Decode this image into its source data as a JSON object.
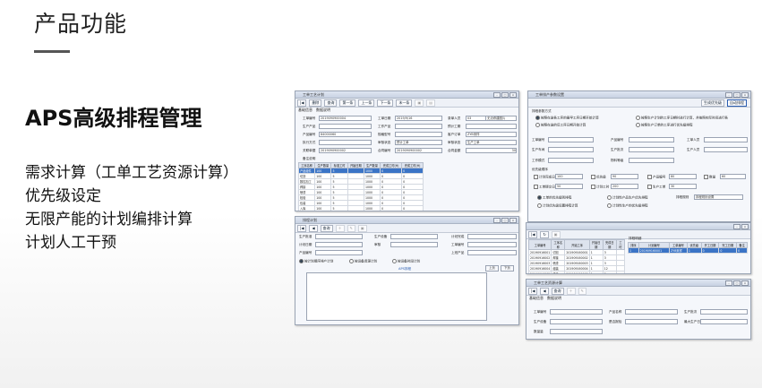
{
  "slide": {
    "title": "产品功能",
    "heading": "APS高级排程管理",
    "features": [
      "需求计算（工单工艺资源计算）",
      "优先级设定",
      "无限产能的计划编排计算",
      "计划人工干预"
    ]
  },
  "win1": {
    "title": "工单工艺计划",
    "toolbar": [
      "删除",
      "查询",
      "第一条",
      "上一条",
      "下一条",
      "末一条"
    ],
    "tabs": [
      "基础信息",
      "数据说明"
    ],
    "fields": [
      {
        "label": "工单编号",
        "value": "2019090900004"
      },
      {
        "label": "工单日期",
        "value": "2019/9/16"
      },
      {
        "label": "录单人员",
        "value": "03"
      },
      {
        "label": "",
        "value": "无法修建图片"
      },
      {
        "label": "生产产品",
        "value": ""
      },
      {
        "label": "工作产品",
        "value": ""
      },
      {
        "label": "预计工期",
        "value": ""
      },
      {
        "label": "产品编号",
        "value": "84000060"
      },
      {
        "label": "规格型号",
        "value": ""
      },
      {
        "label": "客户订单",
        "value": "ZYB采样"
      },
      {
        "label": "执行方式",
        "value": ""
      },
      {
        "label": "审核状态",
        "value": "预计工单"
      },
      {
        "label": "审核状态",
        "value": "生产工单"
      },
      {
        "label": "关联单据",
        "value": "2019090900002"
      },
      {
        "label": "合同编号",
        "value": "2019090900002"
      },
      {
        "label": "合同金额",
        "value": "30"
      },
      {
        "label": "备注说明",
        "value": ""
      }
    ],
    "grid_headers": [
      "工序名称",
      "生产数量",
      "标准工时",
      "开始日期",
      "生产数量",
      "完成工时(H)",
      "完成工时(H)"
    ],
    "grid_rows": [
      [
        "产品组件",
        "100",
        "5",
        "",
        "1000",
        "0",
        "0"
      ],
      [
        "切割",
        "100",
        "5",
        "",
        "1000",
        "0",
        "0"
      ],
      [
        "数控加工",
        "100",
        "5",
        "",
        "1000",
        "0",
        "0"
      ],
      [
        "焊接",
        "100",
        "5",
        "",
        "1000",
        "0",
        "0"
      ],
      [
        "喷漆",
        "100",
        "5",
        "",
        "1000",
        "0",
        "0"
      ],
      [
        "检验",
        "100",
        "5",
        "",
        "1000",
        "0",
        "0"
      ],
      [
        "包装",
        "100",
        "5",
        "",
        "1000",
        "0",
        "0"
      ],
      [
        "入库",
        "100",
        "5",
        "",
        "1000",
        "0",
        "0"
      ]
    ]
  },
  "win2": {
    "title": "排程计划",
    "toolbar": [
      "查询"
    ],
    "fields": [
      "生产批准",
      "生产设备",
      "计划完成",
      "计划日期",
      "审核",
      "工单编号",
      "产品编号",
      "上班产品"
    ],
    "radios": [
      "按计划顺序排产计划",
      "按设备资源计划",
      "按设备时段计划"
    ],
    "buttons": [
      "上页",
      "下页"
    ],
    "link": "APS排程"
  },
  "win3": {
    "title": "工单排产参数设置",
    "toolbar": [
      "生成优先级",
      "自动排程"
    ],
    "section1": "排程参数方式",
    "radios": [
      "按照在途各工序的最早工序日期开始计算",
      "按照生产计划的工序日期时进行计算，并按照实际时间进行各",
      "按照在途的后工序日期开始计算",
      "按照生产订单的工序进行优先级排程"
    ],
    "fields": [
      "工单编号",
      "产品编号",
      "工单人员",
      "生产车间",
      "生产批次",
      "生产人员",
      "工作模式",
      "物料等级"
    ],
    "section2": "优先级顺序",
    "checks": [
      {
        "label": "计划完成日",
        "value": "100"
      },
      {
        "label": "优先级",
        "value": "90"
      },
      {
        "label": "产品编号",
        "value": "80"
      },
      {
        "label": "数量",
        "value": "60"
      },
      {
        "label": "工单提交日",
        "value": "50"
      },
      {
        "label": "计划工时",
        "value": "200"
      },
      {
        "label": "生产工单",
        "value": "30"
      }
    ],
    "options": [
      "工单的优先级别排程",
      "计划性产品生产优先排程",
      "计划优先级设置排程计算",
      "计划性生产的优先级排程"
    ],
    "sort_label": "排程规则",
    "sort_value": "排程规则设置"
  },
  "win4": {
    "grid_headers": [
      "工单编号",
      "工序名称",
      "开始工序",
      "开始日期",
      "完成日期",
      "工时"
    ],
    "grid_rows": [
      [
        "20190916001",
        "切割",
        "201909160001",
        "1",
        "3",
        ""
      ],
      [
        "20190916002",
        "焊接",
        "201909160002",
        "1",
        "3",
        ""
      ],
      [
        "20190916003",
        "喷漆",
        "201909160003",
        "1",
        "3",
        ""
      ],
      [
        "20190916004",
        "组装",
        "201909160004",
        "1",
        "12",
        ""
      ],
      [
        "20190916005",
        "检验",
        "201909160005",
        "1",
        "3",
        ""
      ],
      [
        "20190916006",
        "包装",
        "201909160006",
        "1",
        "1",
        ""
      ]
    ],
    "right_headers": [
      "排序",
      "计划编号",
      "工单编号",
      "优先级",
      "开工日期",
      "完工日期",
      "备注"
    ],
    "right_rows": [
      [
        "1",
        "201909160001",
        "ZYB采样",
        "1",
        "0",
        "0",
        "0"
      ]
    ],
    "right_title": "排程明细"
  },
  "win5": {
    "title": "工单工艺资源计算",
    "toolbar": [
      "查询"
    ],
    "tabs": [
      "基础信息",
      "数据说明"
    ],
    "fields": [
      "工单编号",
      "产品名称",
      "生产批次",
      "生产设备",
      "生产数量",
      "是否报检",
      "生产日期",
      "最大生产日",
      "完工日期",
      "数量量"
    ]
  }
}
